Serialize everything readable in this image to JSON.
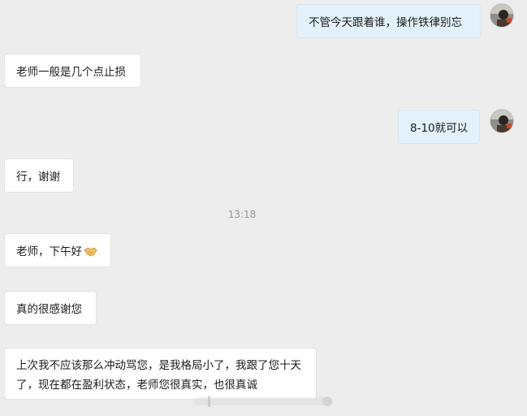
{
  "messages": [
    {
      "side": "out",
      "text": "不管今天跟着谁，操作铁律别忘"
    },
    {
      "side": "in",
      "text": "老师一般是几个点止损"
    },
    {
      "side": "out",
      "text": "8-10就可以"
    },
    {
      "side": "in",
      "text": "行，谢谢"
    },
    {
      "side": "time",
      "text": "13:18"
    },
    {
      "side": "in",
      "text": "老师，下午好",
      "emoji": "handshake-emoji"
    },
    {
      "side": "in",
      "text": "真的很感谢您"
    },
    {
      "side": "in",
      "text": "上次我不应该那么冲动骂您，是我格局小了，我跟了您十天了，现在都在盈利状态，老师您很真实，也很真诚"
    }
  ],
  "colors": {
    "background": "#ededed",
    "incoming_bubble": "#ffffff",
    "outgoing_bubble": "#e2f1fb",
    "timestamp": "#999999"
  }
}
